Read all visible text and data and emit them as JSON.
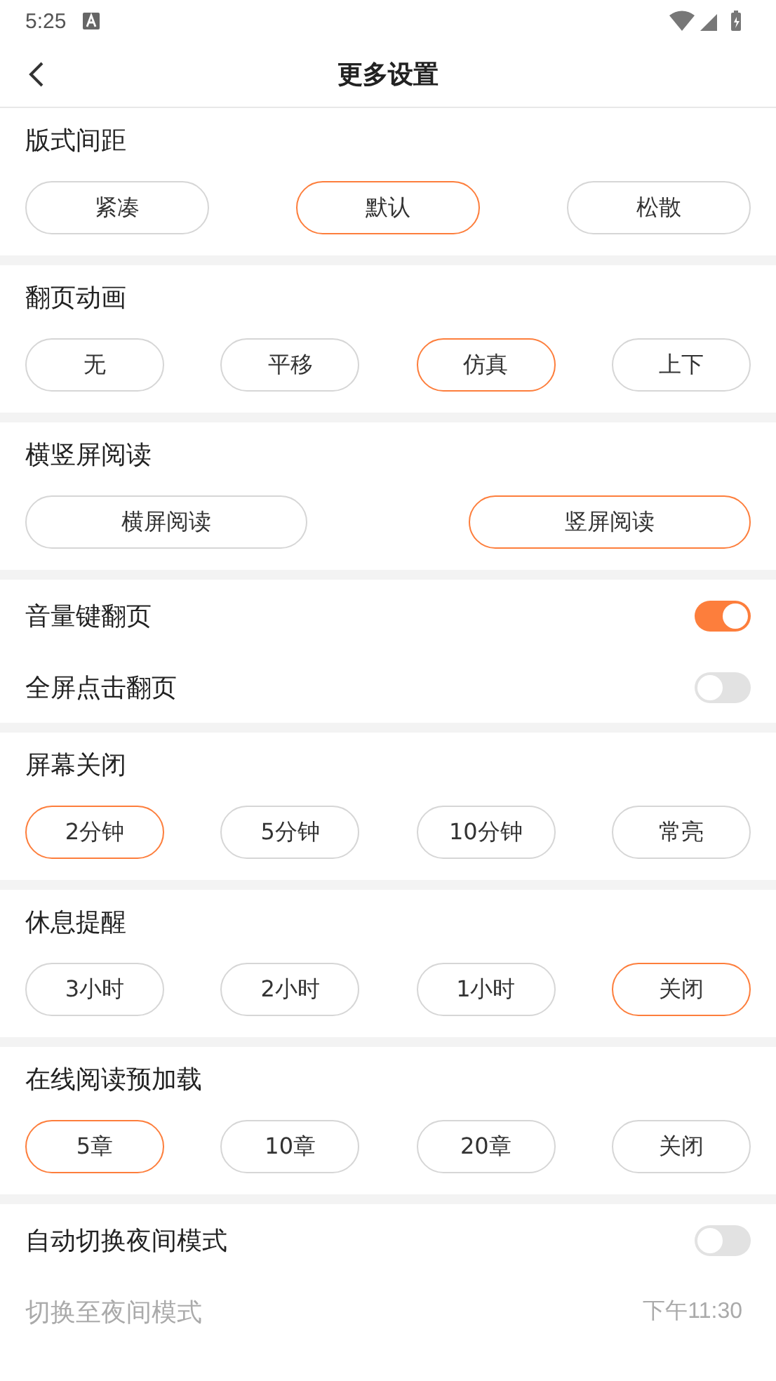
{
  "status_bar": {
    "time": "5:25"
  },
  "header": {
    "title": "更多设置"
  },
  "sections": [
    {
      "kind": "choices",
      "title": "版式间距",
      "options": [
        {
          "label": "紧凑",
          "selected": false
        },
        {
          "label": "默认",
          "selected": true
        },
        {
          "label": "松散",
          "selected": false
        }
      ]
    },
    {
      "kind": "choices",
      "title": "翻页动画",
      "options": [
        {
          "label": "无",
          "selected": false
        },
        {
          "label": "平移",
          "selected": false
        },
        {
          "label": "仿真",
          "selected": true
        },
        {
          "label": "上下",
          "selected": false
        }
      ]
    },
    {
      "kind": "choices",
      "title": "横竖屏阅读",
      "options": [
        {
          "label": "横屏阅读",
          "selected": false
        },
        {
          "label": "竖屏阅读",
          "selected": true
        }
      ]
    },
    {
      "kind": "rows",
      "rows": [
        {
          "kind": "toggle",
          "label": "音量键翻页",
          "on": true
        },
        {
          "kind": "toggle",
          "label": "全屏点击翻页",
          "on": false
        }
      ]
    },
    {
      "kind": "choices",
      "title": "屏幕关闭",
      "options": [
        {
          "label": "2分钟",
          "selected": true
        },
        {
          "label": "5分钟",
          "selected": false
        },
        {
          "label": "10分钟",
          "selected": false
        },
        {
          "label": "常亮",
          "selected": false
        }
      ]
    },
    {
      "kind": "choices",
      "title": "休息提醒",
      "options": [
        {
          "label": "3小时",
          "selected": false
        },
        {
          "label": "2小时",
          "selected": false
        },
        {
          "label": "1小时",
          "selected": false
        },
        {
          "label": "关闭",
          "selected": true
        }
      ]
    },
    {
      "kind": "choices",
      "title": "在线阅读预加载",
      "options": [
        {
          "label": "5章",
          "selected": true
        },
        {
          "label": "10章",
          "selected": false
        },
        {
          "label": "20章",
          "selected": false
        },
        {
          "label": "关闭",
          "selected": false
        }
      ]
    },
    {
      "kind": "rows",
      "rows": [
        {
          "kind": "toggle",
          "label": "自动切换夜间模式",
          "on": false
        },
        {
          "kind": "time",
          "label": "切换至夜间模式",
          "value": "下午11:30",
          "disabled": true
        }
      ]
    }
  ]
}
